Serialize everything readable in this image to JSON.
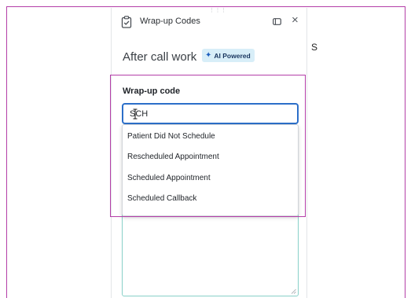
{
  "window": {
    "title": "Wrap-up Codes",
    "icons": [
      "clipboard-icon",
      "collapse-panel-icon",
      "close-icon",
      "drag-grip-icon"
    ]
  },
  "section": {
    "title": "After call work",
    "badge": "AI Powered",
    "badge_icon": "sparkle-icon"
  },
  "wrap_up": {
    "label": "Wrap-up code",
    "input_value": "SCH",
    "options": [
      "Patient Did Not Schedule",
      "Rescheduled Appointment",
      "Scheduled Appointment",
      "Scheduled Callback"
    ]
  },
  "edge_glyph": "S",
  "colors": {
    "highlight": "#b43ea8",
    "input_focus": "#2c6fc9",
    "badge_bg": "#d8eef8",
    "notes_border": "#88d0c8"
  }
}
